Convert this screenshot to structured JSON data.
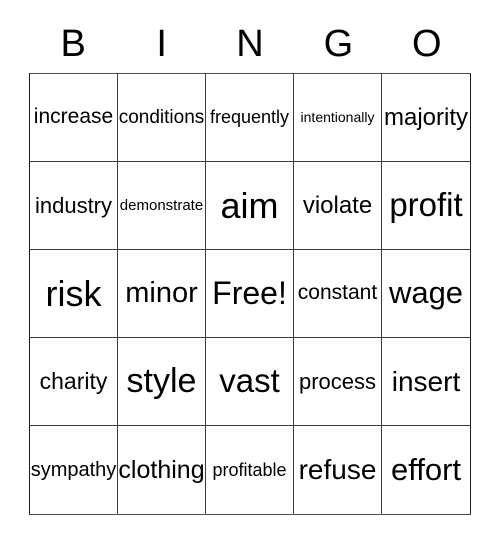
{
  "card": {
    "title": "BINGO Card",
    "background_color": "#ffffff",
    "text_color": "#000000",
    "border_color": "#3a3a3a"
  },
  "header": {
    "letters": [
      "B",
      "I",
      "N",
      "G",
      "O"
    ]
  },
  "grid": {
    "rows": 5,
    "columns": 5,
    "free_space": {
      "row": 2,
      "column": 2,
      "label": "Free!"
    },
    "cells": [
      [
        {
          "label": "increase",
          "font_size": 21
        },
        {
          "label": "conditions",
          "font_size": 19
        },
        {
          "label": "frequently",
          "font_size": 18
        },
        {
          "label": "intentionally",
          "font_size": 14
        },
        {
          "label": "majority",
          "font_size": 24
        }
      ],
      [
        {
          "label": "industry",
          "font_size": 22
        },
        {
          "label": "demonstrate",
          "font_size": 15
        },
        {
          "label": "aim",
          "font_size": 36
        },
        {
          "label": "violate",
          "font_size": 24
        },
        {
          "label": "profit",
          "font_size": 33
        }
      ],
      [
        {
          "label": "risk",
          "font_size": 36
        },
        {
          "label": "minor",
          "font_size": 29
        },
        {
          "label": "Free!",
          "font_size": 32
        },
        {
          "label": "constant",
          "font_size": 21
        },
        {
          "label": "wage",
          "font_size": 31
        }
      ],
      [
        {
          "label": "charity",
          "font_size": 23
        },
        {
          "label": "style",
          "font_size": 34
        },
        {
          "label": "vast",
          "font_size": 33
        },
        {
          "label": "process",
          "font_size": 22
        },
        {
          "label": "insert",
          "font_size": 28
        }
      ],
      [
        {
          "label": "sympathy",
          "font_size": 20
        },
        {
          "label": "clothing",
          "font_size": 25
        },
        {
          "label": "profitable",
          "font_size": 18
        },
        {
          "label": "refuse",
          "font_size": 28
        },
        {
          "label": "effort",
          "font_size": 31
        }
      ]
    ]
  }
}
